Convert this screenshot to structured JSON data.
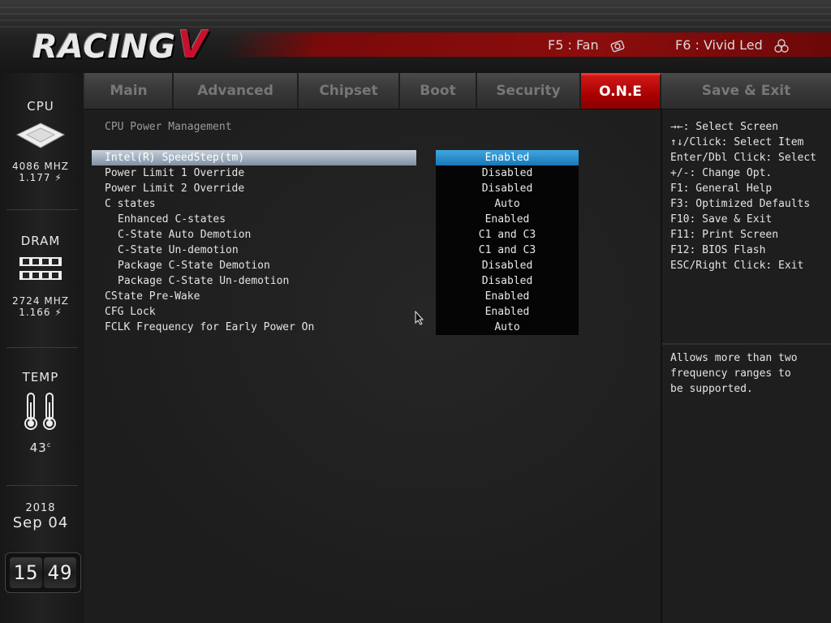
{
  "header": {
    "logo_text": "RACING",
    "logo_mark": "V",
    "hotkeys": [
      {
        "label": "F5 : Fan",
        "icon": "fan-icon"
      },
      {
        "label": "F6 : Vivid Led",
        "icon": "led-icon"
      }
    ],
    "colors": {
      "accent": "#c8102e",
      "selected_value": "#2a8fd0"
    }
  },
  "sidebar": {
    "cpu": {
      "title": "CPU",
      "freq": "4086 MHZ",
      "voltage": "1.177"
    },
    "dram": {
      "title": "DRAM",
      "freq": "2724 MHZ",
      "voltage": "1.166"
    },
    "temp": {
      "title": "TEMP",
      "value": "43",
      "unit": "c"
    },
    "date": {
      "year": "2018",
      "month_day": "Sep 04"
    },
    "clock": {
      "hours": "15",
      "minutes": "49"
    }
  },
  "tabs": [
    {
      "label": "Main",
      "active": false
    },
    {
      "label": "Advanced",
      "active": false
    },
    {
      "label": "Chipset",
      "active": false
    },
    {
      "label": "Boot",
      "active": false
    },
    {
      "label": "Security",
      "active": false
    },
    {
      "label": "O.N.E",
      "active": true
    },
    {
      "label": "Save & Exit",
      "active": false
    }
  ],
  "main": {
    "section_title": "CPU Power Management",
    "settings": [
      {
        "label": "Intel(R) SpeedStep(tm)",
        "value": "Enabled"
      },
      {
        "label": "Power Limit 1 Override",
        "value": "Disabled"
      },
      {
        "label": "Power Limit 2 Override",
        "value": "Disabled"
      },
      {
        "label": "C states",
        "value": "Auto"
      },
      {
        "label": "Enhanced C-states",
        "value": "Enabled"
      },
      {
        "label": "C-State Auto Demotion",
        "value": "C1 and C3"
      },
      {
        "label": "C-State Un-demotion",
        "value": "C1 and C3"
      },
      {
        "label": "Package C-State Demotion",
        "value": "Disabled"
      },
      {
        "label": "Package C-State Un-demotion",
        "value": "Disabled"
      },
      {
        "label": "CState Pre-Wake",
        "value": "Enabled"
      },
      {
        "label": "CFG Lock",
        "value": "Enabled"
      },
      {
        "label": "FCLK Frequency for Early Power On",
        "value": "Auto"
      }
    ]
  },
  "help": {
    "keys": [
      "→←: Select Screen",
      "↑↓/Click: Select Item",
      "Enter/Dbl Click: Select",
      "+/-: Change Opt.",
      "F1: General Help",
      "F3: Optimized Defaults",
      "F10: Save & Exit",
      "F11: Print Screen",
      "F12: BIOS Flash",
      "ESC/Right Click: Exit"
    ],
    "description": [
      "Allows more than two",
      "frequency ranges to",
      "be supported."
    ]
  }
}
